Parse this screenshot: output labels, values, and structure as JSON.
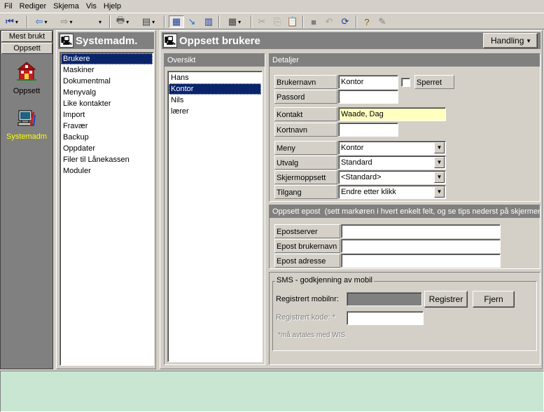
{
  "menu": [
    "Fil",
    "Rediger",
    "Skjema",
    "Vis",
    "Hjelp"
  ],
  "nav": {
    "buttons": [
      "Mest brukt",
      "Oppsett"
    ],
    "items": [
      {
        "label": "Oppsett",
        "color": "#ffffff"
      },
      {
        "label": "Systemadm",
        "color": "#ffff00"
      }
    ]
  },
  "module_panel": {
    "title": "Systemadm.",
    "items": [
      "Brukere",
      "Maskiner",
      "Dokumentmal",
      "Menyvalg",
      "Like kontakter",
      "Import",
      "Fravær",
      "Backup",
      "Oppdater",
      "Filer til Lånekassen",
      "Moduler"
    ],
    "selected": "Brukere"
  },
  "main": {
    "title": "Oppsett brukere",
    "action_button": "Handling"
  },
  "overview": {
    "header": "Oversikt",
    "users": [
      "Hans",
      "Kontor",
      "Nils",
      "lærer"
    ],
    "selected": "Kontor"
  },
  "details": {
    "header": "Detaljer",
    "username_label": "Brukernavn",
    "username": "Kontor",
    "blocked_label": "Sperret",
    "password_label": "Passord",
    "password": "",
    "contact_label": "Kontakt",
    "contact": "Waade, Dag",
    "shortname_label": "Kortnavn",
    "shortname": "",
    "menu_label": "Meny",
    "menu_value": "Kontor",
    "selection_label": "Utvalg",
    "selection_value": "Standard",
    "screen_label": "Skjermoppsett",
    "screen_value": "<Standard>",
    "access_label": "Tilgang",
    "access_value": "Endre etter klikk"
  },
  "email": {
    "header": "Oppsett epost",
    "hint": "(sett markøren i hvert enkelt felt, og se tips nederst på skjermen)",
    "server_label": "Epostserver",
    "user_label": "Epost brukernavn",
    "address_label": "Epost adresse"
  },
  "sms": {
    "legend": "SMS - godkjenning av mobil",
    "mobile_label": "Registrert mobilnr:",
    "register_button": "Registrer",
    "remove_button": "Fjern",
    "code_label": "Registrert kode: *",
    "note": "*må avtales med WIS"
  },
  "colors": {
    "accent": "#0a246a",
    "status_bar": "#c8e6d2",
    "contact_field": "#ffffc0"
  }
}
